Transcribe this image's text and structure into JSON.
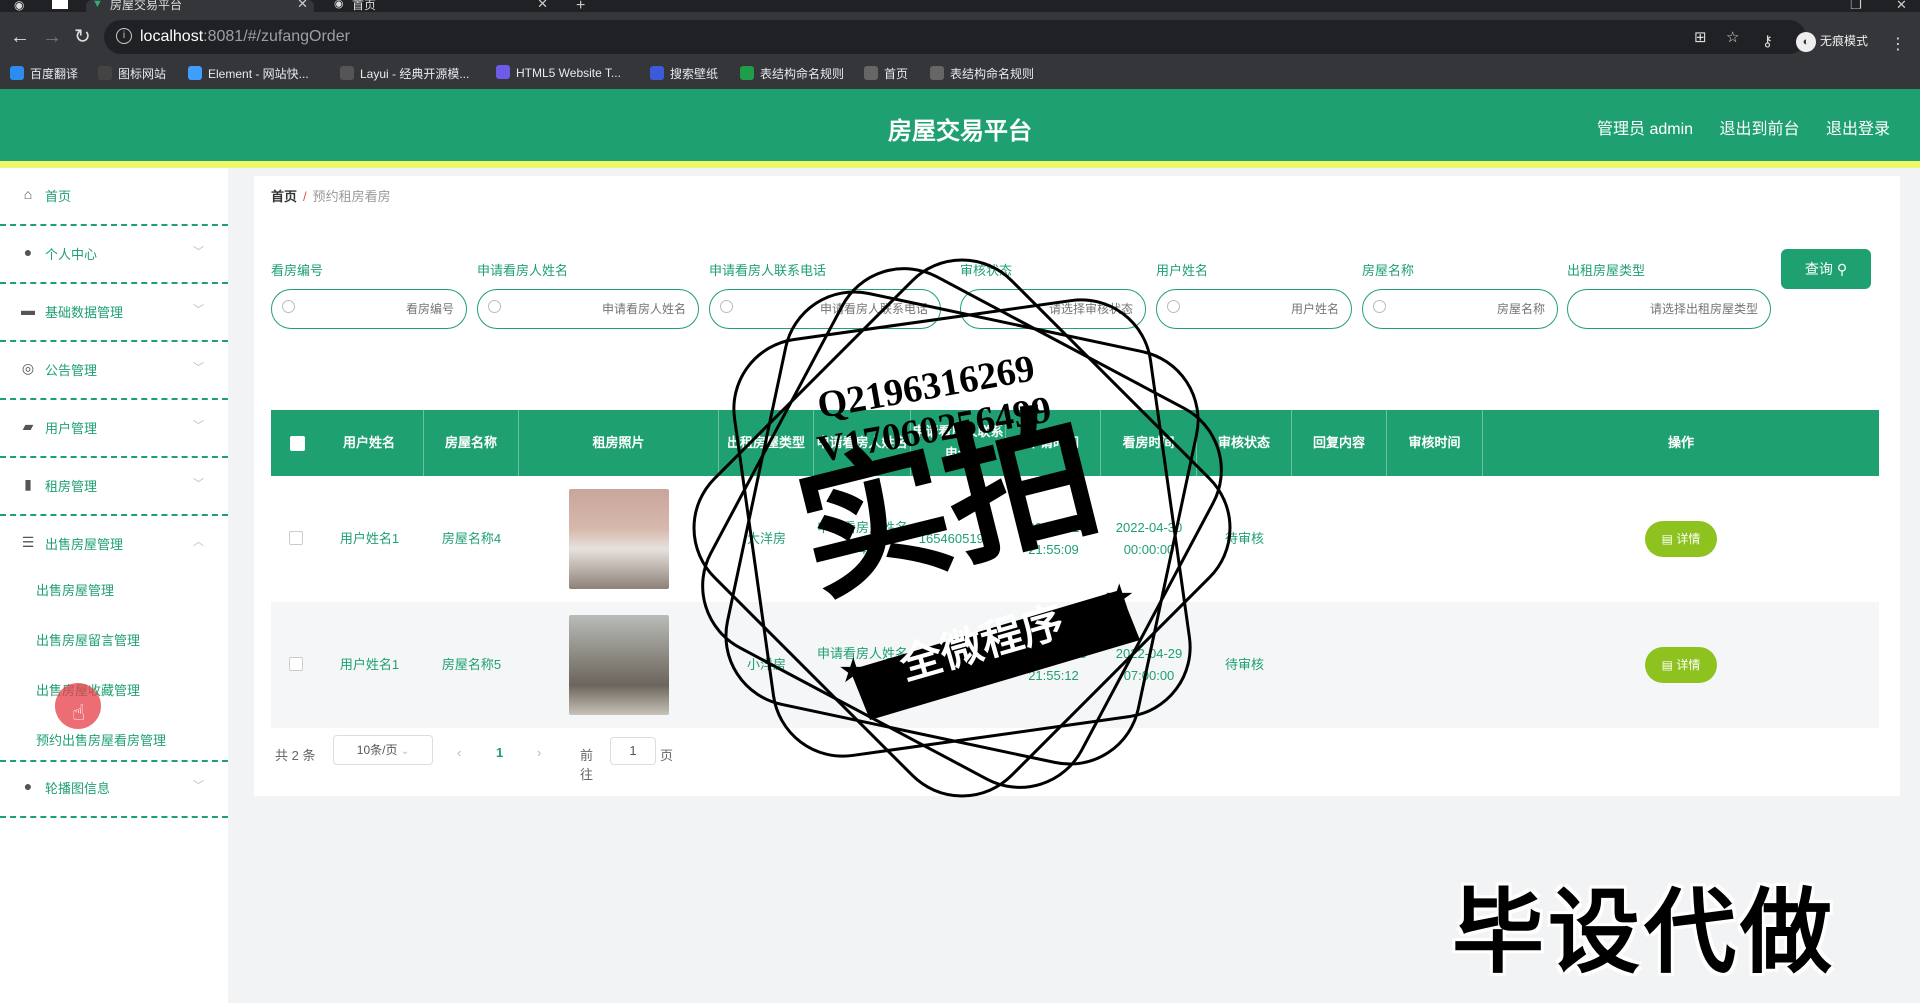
{
  "browser": {
    "tabs": [
      {
        "title": "房屋交易平台"
      },
      {
        "title": "首页"
      }
    ],
    "url_host": "localhost",
    "url_rest": ":8081/#/zufangOrder",
    "incognito_label": "无痕模式",
    "bookmarks": [
      {
        "label": "百度翻译",
        "icon": "translate-icon",
        "color": "#2d8cf0"
      },
      {
        "label": "图标网站",
        "icon": "flag-icon",
        "color": "#444444"
      },
      {
        "label": "Element - 网站快...",
        "icon": "element-icon",
        "color": "#409eff"
      },
      {
        "label": "Layui - 经典开源模...",
        "icon": "layui-icon",
        "color": "#555555"
      },
      {
        "label": "HTML5 Website T...",
        "icon": "html5-icon",
        "color": "#6c5ce7"
      },
      {
        "label": "搜索壁纸",
        "icon": "wallpaper-icon",
        "color": "#3b5bdb"
      },
      {
        "label": "表结构命名规则",
        "icon": "sheet-icon",
        "color": "#1e9e4a"
      },
      {
        "label": "首页",
        "icon": "globe-icon",
        "color": "#666666"
      },
      {
        "label": "表结构命名规则",
        "icon": "globe-icon",
        "color": "#666666"
      }
    ]
  },
  "header": {
    "title": "房屋交易平台",
    "admin_label": "管理员 admin",
    "front_link": "退出到前台",
    "logout_link": "退出登录",
    "brand_color": "#1fa070",
    "strip_color": "#eef86a"
  },
  "sidebar": {
    "items": [
      {
        "label": "首页",
        "icon": "home-icon"
      },
      {
        "label": "个人中心",
        "icon": "user-icon"
      },
      {
        "label": "基础数据管理",
        "icon": "database-icon"
      },
      {
        "label": "公告管理",
        "icon": "notice-icon"
      },
      {
        "label": "用户管理",
        "icon": "users-icon"
      },
      {
        "label": "租房管理",
        "icon": "rent-icon"
      },
      {
        "label": "出售房屋管理",
        "icon": "list-icon"
      },
      {
        "label": "轮播图信息",
        "icon": "carousel-icon"
      }
    ],
    "subitems": [
      {
        "label": "出售房屋管理"
      },
      {
        "label": "出售房屋留言管理"
      },
      {
        "label": "出售房屋收藏管理"
      },
      {
        "label": "预约出售房屋看房管理"
      }
    ]
  },
  "breadcrumb": {
    "home": "首页",
    "current": "预约租房看房"
  },
  "filters": [
    {
      "label": "看房编号",
      "placeholder": "看房编号",
      "type": "input"
    },
    {
      "label": "申请看房人姓名",
      "placeholder": "申请看房人姓名",
      "type": "input"
    },
    {
      "label": "申请看房人联系电话",
      "placeholder": "申请看房人联系电话",
      "type": "input"
    },
    {
      "label": "审核状态",
      "placeholder": "请选择审核状态",
      "type": "select"
    },
    {
      "label": "用户姓名",
      "placeholder": "用户姓名",
      "type": "input"
    },
    {
      "label": "房屋名称",
      "placeholder": "房屋名称",
      "type": "input"
    },
    {
      "label": "出租房屋类型",
      "placeholder": "请选择出租房屋类型",
      "type": "select"
    }
  ],
  "query_button": "查询",
  "table": {
    "columns": [
      "用户姓名",
      "房屋名称",
      "租房照片",
      "出租房屋类型",
      "申请看房人姓名",
      "申请看房人联系电话",
      "申请时间",
      "看房时间",
      "审核状态",
      "回复内容",
      "审核时间",
      "操作"
    ],
    "rows": [
      {
        "user": "用户姓名1",
        "house": "房屋名称4",
        "photo": "photo1",
        "type": "大洋房",
        "applicant": "申请看房人姓名4",
        "phone": "16546051974",
        "apply_time": "2022-04-20 21:55:09",
        "view_time": "2022-04-30 00:00:00",
        "status": "待审核",
        "reply": "",
        "audit_time": "",
        "action": "详情"
      },
      {
        "user": "用户姓名1",
        "house": "房屋名称5",
        "photo": "photo2",
        "type": "小洋房",
        "applicant": "申请看房人姓名5",
        "phone": "17703789595",
        "apply_time": "2022-04-20 21:55:12",
        "view_time": "2022-04-29 07:00:00",
        "status": "待审核",
        "reply": "",
        "audit_time": "",
        "action": "详情"
      }
    ]
  },
  "pagination": {
    "total": "共 2 条",
    "page_size": "10条/页",
    "current": "1",
    "goto_label": "前往",
    "goto_value": "1",
    "page_suffix": "页"
  },
  "watermark": {
    "qq": "Q2196316269",
    "vx": "V17060256499",
    "big": "实拍",
    "band": "全微程序",
    "corner": "毕设代做"
  }
}
